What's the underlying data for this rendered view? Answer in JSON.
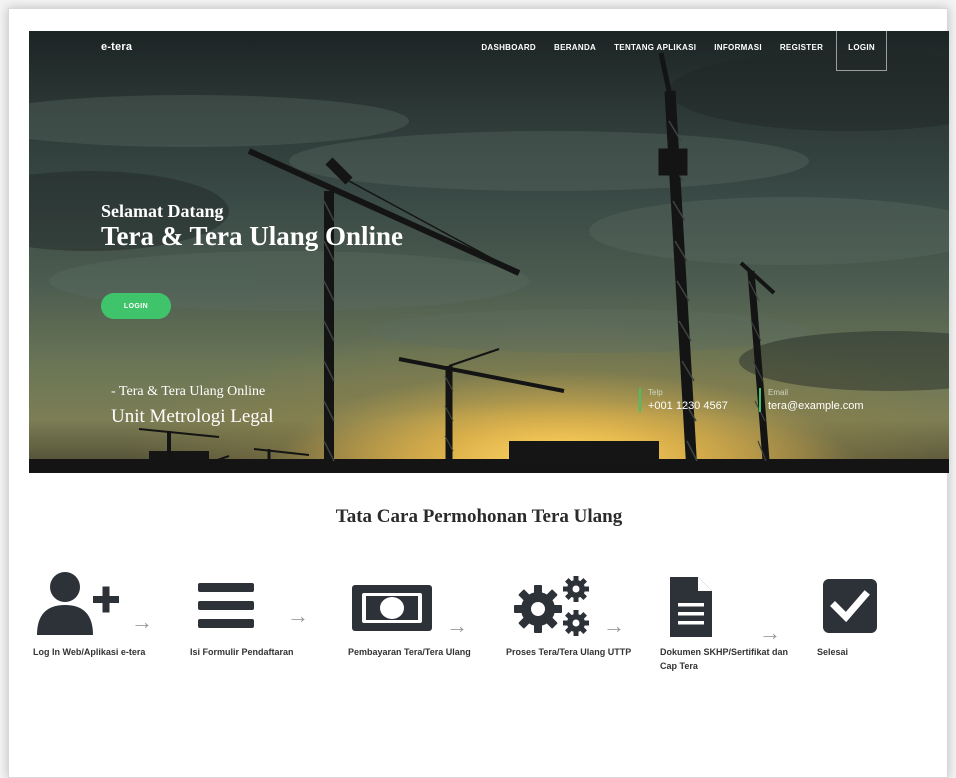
{
  "brand": {
    "logo_text": "e-tera"
  },
  "nav": {
    "items": [
      {
        "label": "DASHBOARD"
      },
      {
        "label": "BERANDA"
      },
      {
        "label": "TENTANG APLIKASI"
      },
      {
        "label": "INFORMASI"
      },
      {
        "label": "REGISTER"
      },
      {
        "label": "LOGIN"
      }
    ]
  },
  "hero": {
    "welcome": "Selamat Datang",
    "title": "Tera & Tera Ulang Online",
    "button_label": "LOGIN",
    "tagline": "- Tera & Tera Ulang Online",
    "unit": "Unit Metrologi Legal",
    "contact_phone": {
      "label": "Telp",
      "value": "+001 1230 4567"
    },
    "contact_email": {
      "label": "Email",
      "value": "tera@example.com"
    }
  },
  "steps": {
    "title": "Tata Cara Permohonan Tera Ulang",
    "arrow_glyph": "→",
    "items": [
      {
        "label": "Log In Web/Aplikasi e-tera",
        "icon": "user-plus-icon"
      },
      {
        "label": "Isi Formulir Pendaftaran",
        "icon": "bars-icon"
      },
      {
        "label": "Pembayaran Tera/Tera Ulang",
        "icon": "money-bill-icon"
      },
      {
        "label": "Proses Tera/Tera Ulang UTTP",
        "icon": "cogs-icon"
      },
      {
        "label": "Dokumen SKHP/Sertifikat dan Cap Tera",
        "icon": "file-document-icon"
      },
      {
        "label": "Selesai",
        "icon": "check-square-icon"
      }
    ]
  },
  "colors": {
    "accent": "#3fc46c",
    "icon": "#2d3138",
    "text": "#333333"
  }
}
